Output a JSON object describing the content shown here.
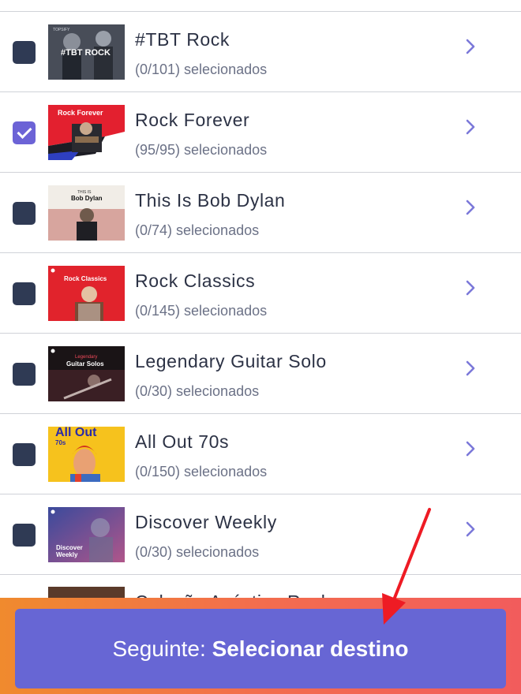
{
  "playlists": [
    {
      "title": "#TBT Rock",
      "count": "(0/101) selecionados",
      "checked": false,
      "cover_text": "#TBT ROCK",
      "cover_label": "tbt"
    },
    {
      "title": "Rock Forever",
      "count": "(95/95) selecionados",
      "checked": true,
      "cover_text": "Rock Forever",
      "cover_label": "rockforever"
    },
    {
      "title": "This Is Bob Dylan",
      "count": "(0/74) selecionados",
      "checked": false,
      "cover_text_top": "THIS IS",
      "cover_text": "Bob Dylan",
      "cover_label": "dylan"
    },
    {
      "title": "Rock Classics",
      "count": "(0/145) selecionados",
      "checked": false,
      "cover_text": "Rock Classics",
      "cover_label": "classics"
    },
    {
      "title": "Legendary Guitar Solo",
      "count": "(0/30) selecionados",
      "checked": false,
      "cover_text_top": "Legendary",
      "cover_text": "Guitar Solos",
      "cover_label": "guitar"
    },
    {
      "title": "All Out 70s",
      "count": "(0/150) selecionados",
      "checked": false,
      "cover_text_top": "All Out",
      "cover_text": "70s",
      "cover_label": "allout"
    },
    {
      "title": "Discover Weekly",
      "count": "(0/30) selecionados",
      "checked": false,
      "cover_text_top": "Discover",
      "cover_text": "Weekly",
      "cover_label": "discover"
    }
  ],
  "partial_row_title": "Coleção Acústica Rock",
  "next_button": {
    "prefix": "Seguinte: ",
    "action": "Selecionar destino"
  },
  "colors": {
    "accent": "#6766d4",
    "checkbox_unchecked": "#2f3a54",
    "checkbox_checked": "#6c63d6",
    "chevron": "#7b78d9",
    "arrow": "#ee1b24"
  }
}
